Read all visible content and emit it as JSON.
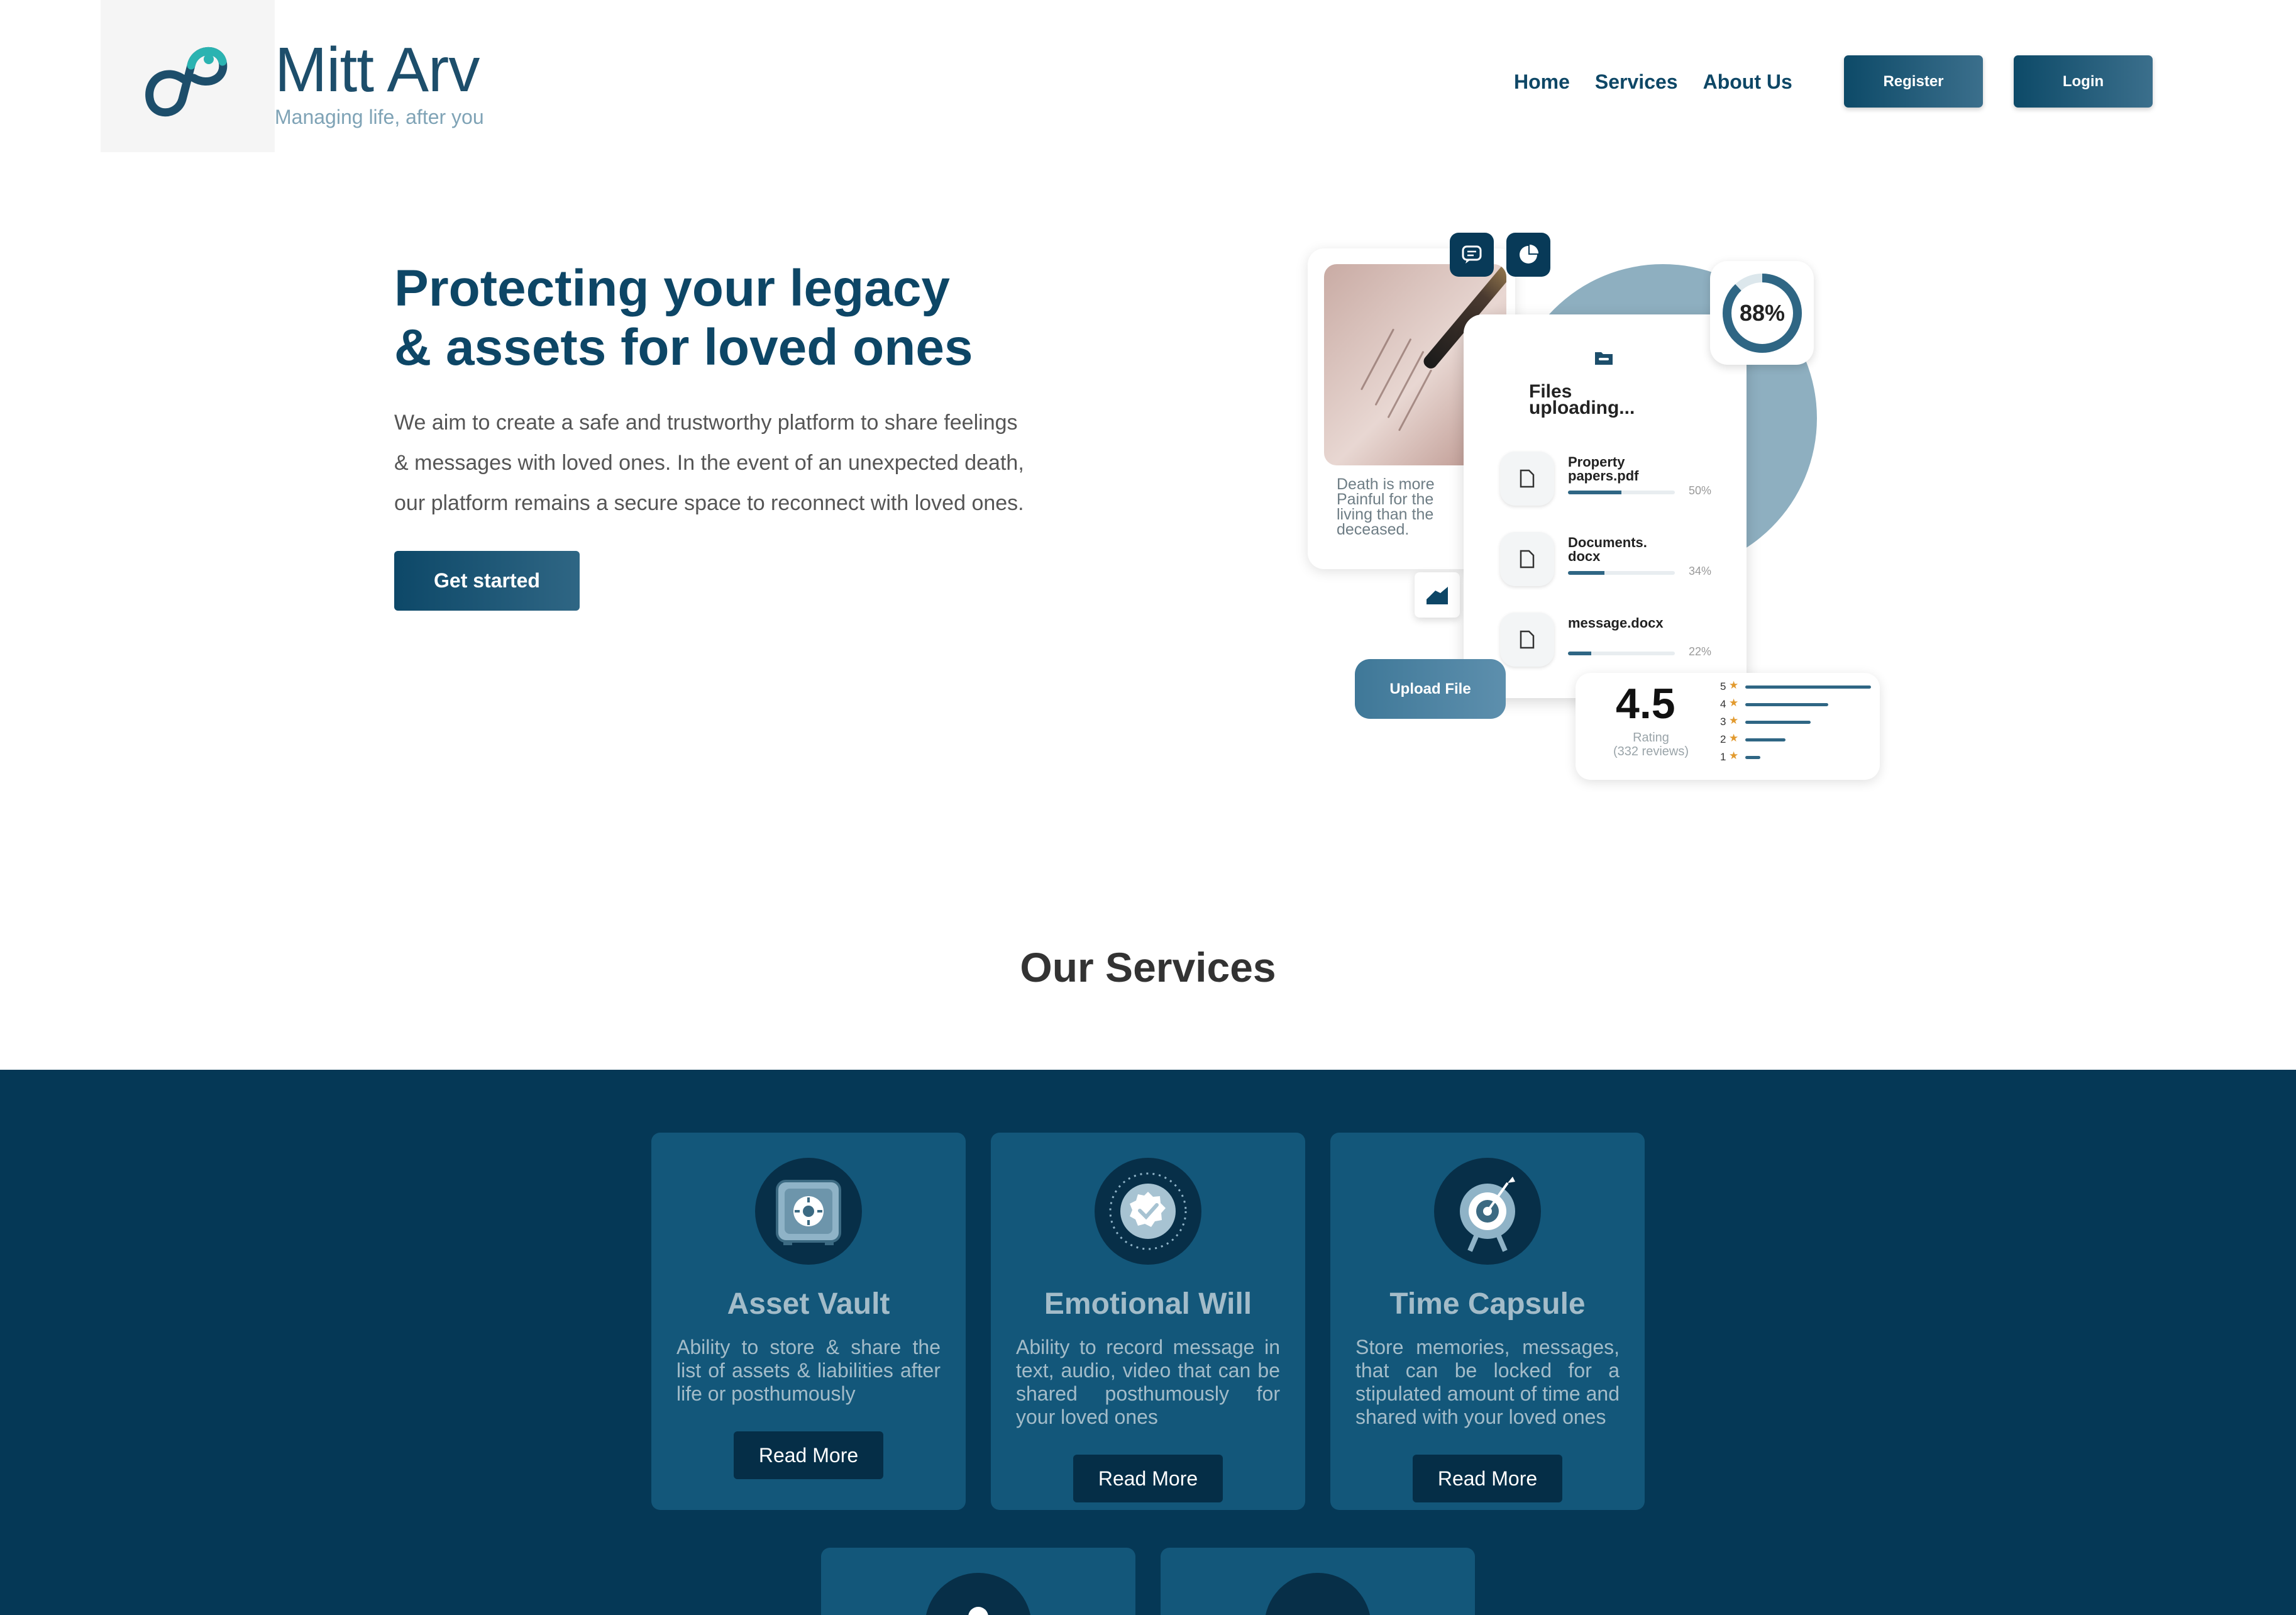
{
  "header": {
    "brand_name": "Mitt Arv",
    "tagline": "Managing life, after you",
    "nav": [
      "Home",
      "Services",
      "About Us"
    ],
    "register_label": "Register",
    "login_label": "Login"
  },
  "hero": {
    "title_line1": "Protecting your legacy",
    "title_line2": "& assets for loved ones",
    "description_line1": "We aim to create a safe and trustworthy platform to share feelings",
    "description_line2": "& messages with loved ones. In the event of an unexpected death,",
    "description_line3": "our platform remains a secure space to reconnect with loved ones.",
    "cta_label": "Get started"
  },
  "illustration": {
    "note_text": "Death is more Painful for the living than the deceased.",
    "files_title_line1": "Files",
    "files_title_line2": "uploading...",
    "files": [
      {
        "name": "Property papers.pdf",
        "progress": 0.5,
        "pct_label": "50%"
      },
      {
        "name": "Documents. docx",
        "progress": 0.34,
        "pct_label": "34%"
      },
      {
        "name": "message.docx",
        "progress": 0.22,
        "pct_label": "22%"
      }
    ],
    "percent_badge": "88%",
    "percent_value": 0.88,
    "upload_label": "Upload File",
    "rating_value": "4.5",
    "rating_label": "Rating",
    "rating_reviews": "(332 reviews)",
    "rating_rows": [
      {
        "star": "5",
        "share": 1.0
      },
      {
        "star": "4",
        "share": 0.66
      },
      {
        "star": "3",
        "share": 0.52
      },
      {
        "star": "2",
        "share": 0.32
      },
      {
        "star": "1",
        "share": 0.12
      }
    ],
    "icons": [
      "chat-icon",
      "pie-chart-icon",
      "folder-icon",
      "trend-chart-icon",
      "document-icon",
      "star-icon"
    ]
  },
  "services": {
    "heading": "Our Services",
    "cards": [
      {
        "title": "Asset Vault",
        "desc": "Ability to store & share the list of assets & liabilities after life or posthumously",
        "button": "Read More",
        "icon": "safe-icon"
      },
      {
        "title": "Emotional Will",
        "desc": "Ability to record message in text, audio, video that can be shared posthumously for your loved ones",
        "button": "Read More",
        "icon": "verified-badge-icon"
      },
      {
        "title": "Time Capsule",
        "desc": "Store memories, messages, that can be locked for a stipulated amount of time and shared with your loved ones",
        "button": "Read More",
        "icon": "target-icon"
      }
    ],
    "partial_card_icons": [
      "people-icon",
      "browser-icon"
    ]
  },
  "colors": {
    "brand_dark": "#0d4666",
    "band": "#053856",
    "card": "#13577a",
    "teal_accent": "#2bb3b1"
  }
}
